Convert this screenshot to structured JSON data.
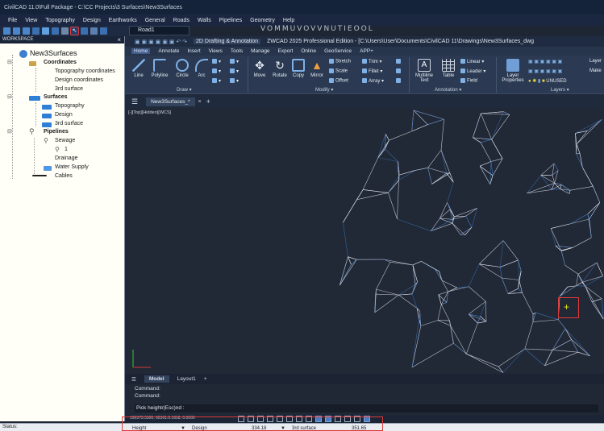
{
  "window": {
    "title": "CivilCAD 11.0\\Full Package - C:\\CC Projects\\3 Surfaces\\New3Surfaces"
  },
  "menu": {
    "items": [
      "File",
      "View",
      "Topography",
      "Design",
      "Earthworks",
      "General",
      "Roads",
      "Walls",
      "Pipelines",
      "Geometry",
      "Help"
    ],
    "glyphs": "VOMMUVOVVNUTIEOOL"
  },
  "toolbar": {
    "road_select": "Road1"
  },
  "workspace": {
    "title": "WORKSPACE",
    "close": "×",
    "root": "New3Surfaces",
    "coordinates": "Coordinates",
    "coord_items": [
      "Topography coordinates",
      "Design coordinates",
      "3rd surface"
    ],
    "surfaces": "Surfaces",
    "surface_items": [
      "Topography",
      "Design",
      "3rd surface"
    ],
    "pipelines": "Pipelines",
    "sewage": "Sewage",
    "sewage_child": "1",
    "drainage": "Drainage",
    "water_supply": "Water Supply",
    "cables": "Cables"
  },
  "ribbon": {
    "workspace_select": "2D Drafting & Annotation",
    "app_title": "ZWCAD 2025 Professional Edition - [C:\\Users\\User\\Documents\\CivilCAD 11\\Drawings\\New3Surfaces_dwg",
    "tabs": [
      "Home",
      "Annotate",
      "Insert",
      "Views",
      "Tools",
      "Manage",
      "Export",
      "Online",
      "GeoService",
      "APP+"
    ],
    "draw": {
      "line": "Line",
      "polyline": "Polyline",
      "circle": "Circle",
      "arc": "Arc",
      "panel": "Draw ▾"
    },
    "modify": {
      "move": "Move",
      "rotate": "Rotate",
      "copy": "Copy",
      "mirror": "Mirror",
      "stretch": "Stretch",
      "scale": "Scale",
      "offset": "Offset",
      "trim": "Trim ▾",
      "fillet": "Fillet ▾",
      "array": "Array ▾",
      "panel": "Modify ▾"
    },
    "annotation": {
      "multiline": "Multiline",
      "text": "Text",
      "table": "Table",
      "linear": "Linear ▾",
      "leader": "Leader ▾",
      "field": "Field",
      "panel": "Annotation ▾"
    },
    "layers": {
      "layer_properties": "Layer",
      "properties": "Properties",
      "layer": "Layer",
      "make": "Make",
      "unused": "UNUSED",
      "panel": "Layers ▾"
    }
  },
  "doc_tabs": {
    "menu": "☰",
    "active": "New3Surfaces_*",
    "close": "×",
    "add": "+"
  },
  "viewport": {
    "label": "[-][Top][Hidden][WCS]"
  },
  "layout_tabs": {
    "menu": "☰",
    "model": "Model",
    "layout1": "Layout1",
    "add": "+"
  },
  "command": {
    "history": [
      "Command:",
      "Command:"
    ],
    "prompt": "Pick height/(Esc)nd :"
  },
  "status": {
    "coords": "190373.5500, 62361.0.1658, 0.0000",
    "label": "Status:",
    "props": [
      {
        "label": "Height",
        "value": ""
      },
      {
        "label": "Design",
        "value": "334.18"
      },
      {
        "label": "3rd surface",
        "value": "351.65"
      }
    ]
  },
  "colors": {
    "highlight": "#e03a3a",
    "background": "#212836",
    "mesh_white": "#d8dde6",
    "mesh_blue": "#3b6fb0"
  }
}
